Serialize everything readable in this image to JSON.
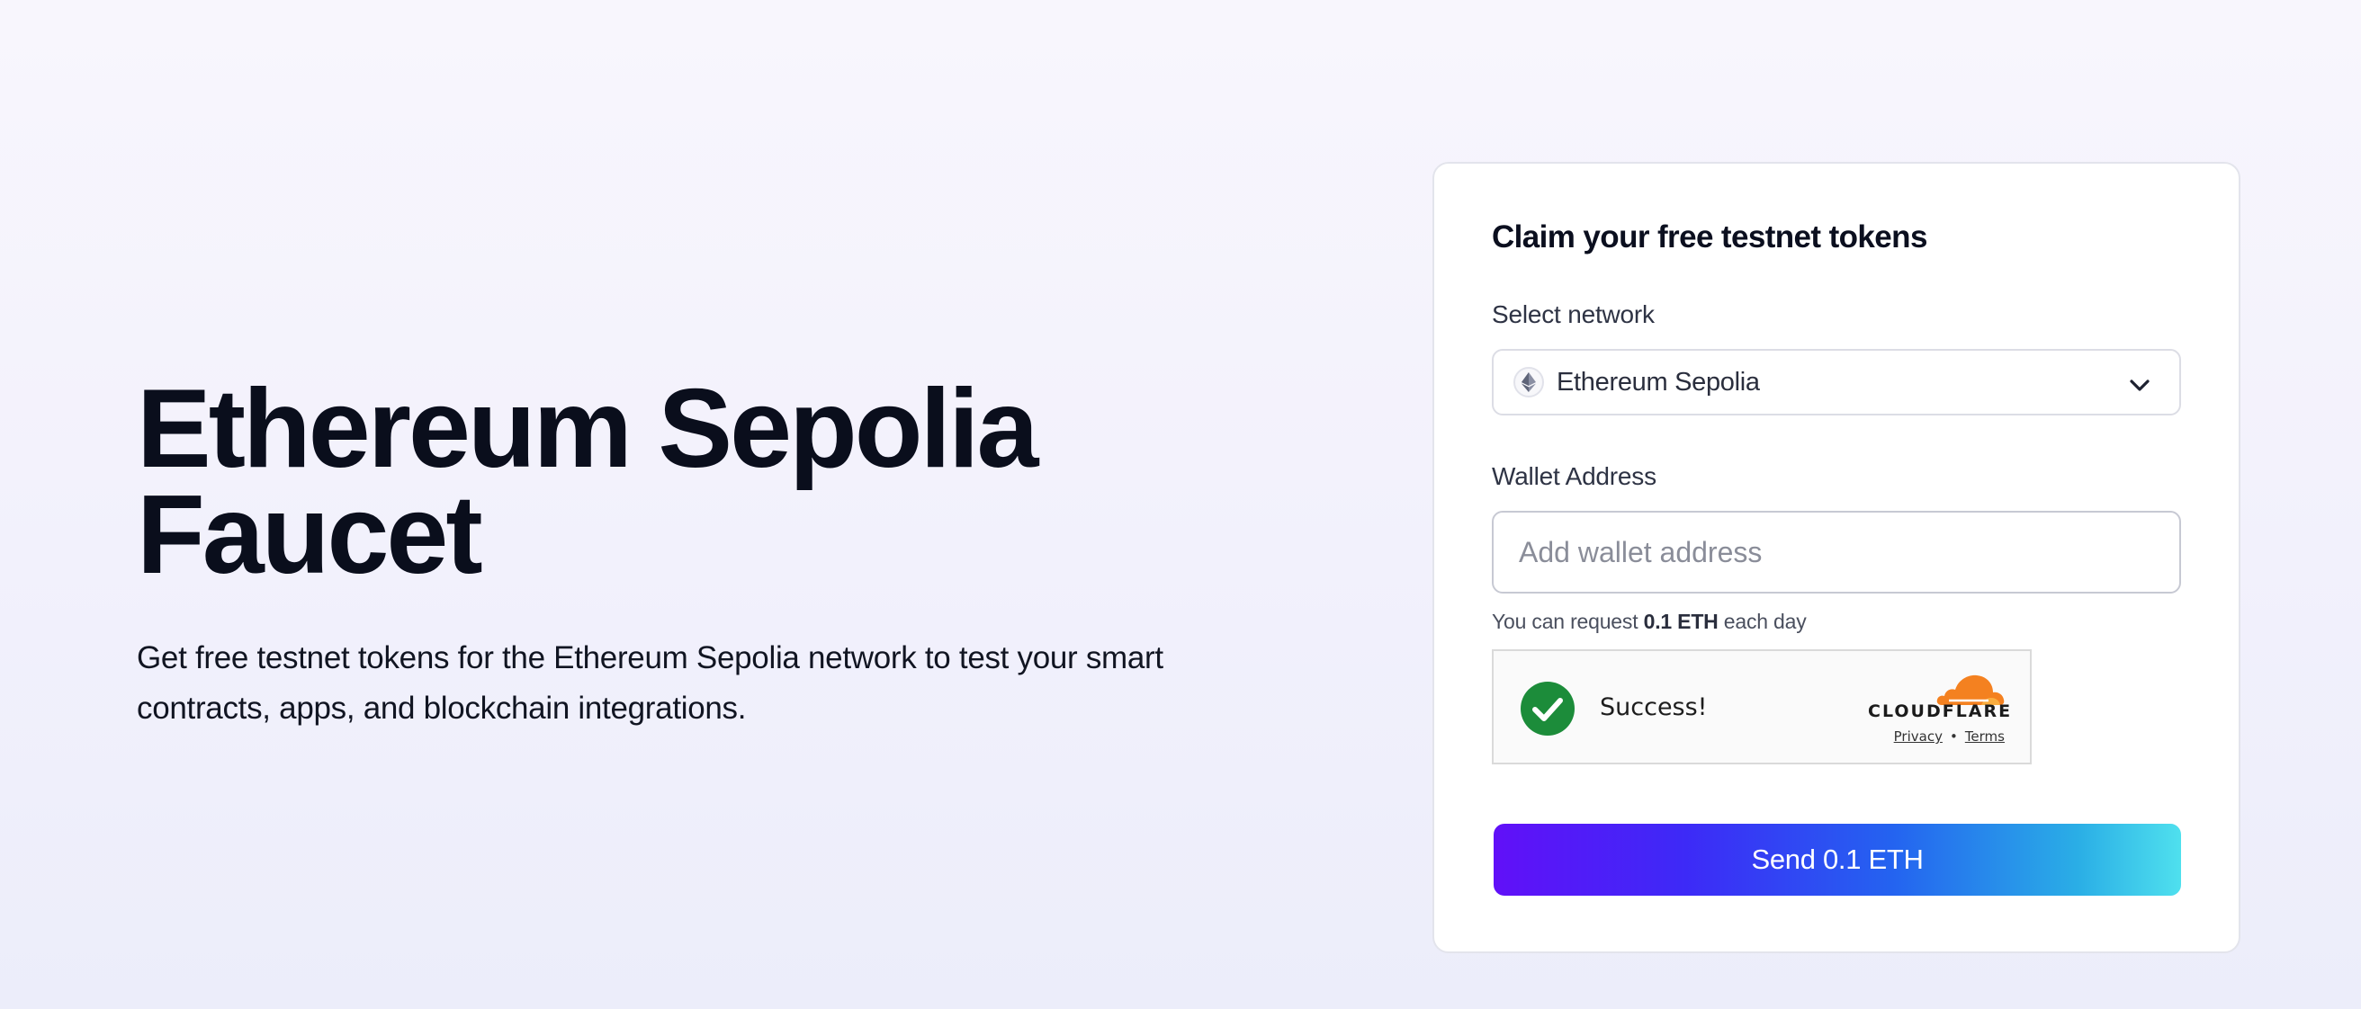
{
  "hero": {
    "title_line1": "Ethereum Sepolia",
    "title_line2": "Faucet",
    "description": "Get free testnet tokens for the Ethereum Sepolia network to test your smart contracts, apps, and blockchain integrations."
  },
  "card": {
    "title": "Claim your free testnet tokens",
    "network": {
      "label": "Select network",
      "selected": "Ethereum Sepolia",
      "icon": "ethereum-icon"
    },
    "wallet": {
      "label": "Wallet Address",
      "placeholder": "Add wallet address",
      "value": ""
    },
    "hint": {
      "prefix": "You can request",
      "amount": "0.1 ETH",
      "suffix": "each day"
    },
    "captcha": {
      "status": "Success!",
      "provider": "CLOUDFLARE",
      "privacy_label": "Privacy",
      "separator": "•",
      "terms_label": "Terms",
      "status_color": "#1c8c3a",
      "brand_color": "#f48120"
    },
    "submit_label": "Send 0.1 ETH"
  }
}
